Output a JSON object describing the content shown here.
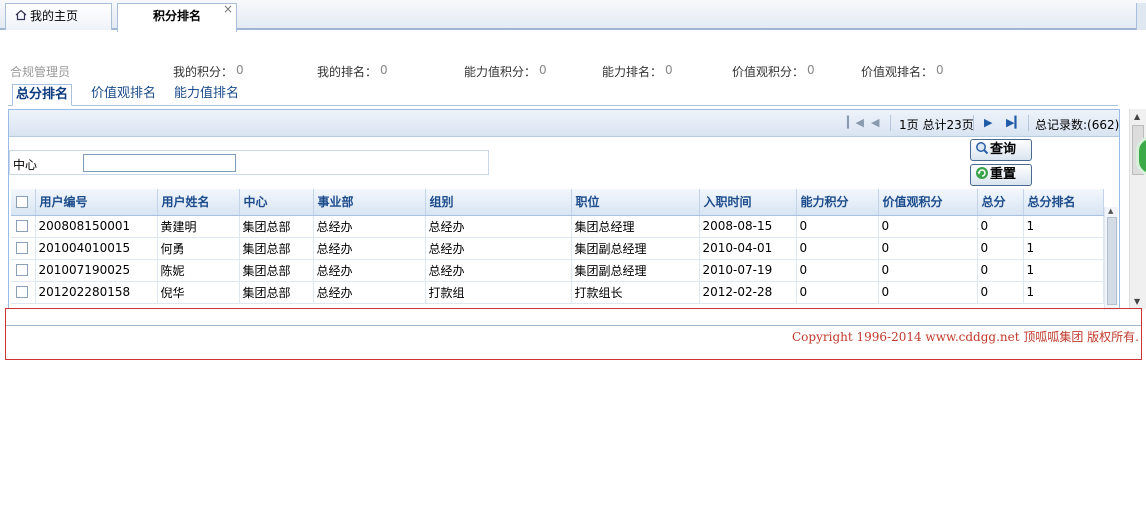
{
  "tabs": [
    {
      "label": "我的主页",
      "icon": "home-icon"
    },
    {
      "label": "积分排名",
      "icon": "close-icon",
      "close": "×"
    }
  ],
  "summary": {
    "role": "合规管理员",
    "my_points_label": "我的积分：",
    "my_points": "0",
    "my_rank_label": "我的排名：",
    "my_rank": "0",
    "ability_points_label": "能力值积分：",
    "ability_points": "0",
    "ability_rank_label": "能力排名：",
    "ability_rank": "0",
    "value_points_label": "价值观积分：",
    "value_points": "0",
    "value_rank_label": "价值观排名：",
    "value_rank": "0"
  },
  "subtabs": [
    "总分排名",
    "价值观排名",
    "能力值排名"
  ],
  "pager": {
    "page_info": "1页 总计23页",
    "total": "总记录数:(662)"
  },
  "search": {
    "label": "中心",
    "value": "",
    "query_button": "查询",
    "reset_button": "重置"
  },
  "table": {
    "columns": [
      "用户编号",
      "用户姓名",
      "中心",
      "事业部",
      "组别",
      "职位",
      "入职时间",
      "能力积分",
      "价值观积分",
      "总分",
      "总分排名"
    ],
    "rows": [
      [
        "200808150001",
        "黄建明",
        "集团总部",
        "总经办",
        "总经办",
        "集团总经理",
        "2008-08-15",
        "0",
        "0",
        "0",
        "1"
      ],
      [
        "201004010015",
        "何勇",
        "集团总部",
        "总经办",
        "总经办",
        "集团副总经理",
        "2010-04-01",
        "0",
        "0",
        "0",
        "1"
      ],
      [
        "201007190025",
        "陈妮",
        "集团总部",
        "总经办",
        "总经办",
        "集团副总经理",
        "2010-07-19",
        "0",
        "0",
        "0",
        "1"
      ],
      [
        "201202280158",
        "倪华",
        "集团总部",
        "总经办",
        "打款组",
        "打款组长",
        "2012-02-28",
        "0",
        "0",
        "0",
        "1"
      ]
    ]
  },
  "footer": {
    "copyright": "Copyright 1996-2014 www.cddgg.net 顶呱呱集团 版权所有."
  },
  "colors": {
    "header_text": "#1c4c8c",
    "copyright_text": "#c0392b",
    "footer_border": "#cc3333"
  }
}
